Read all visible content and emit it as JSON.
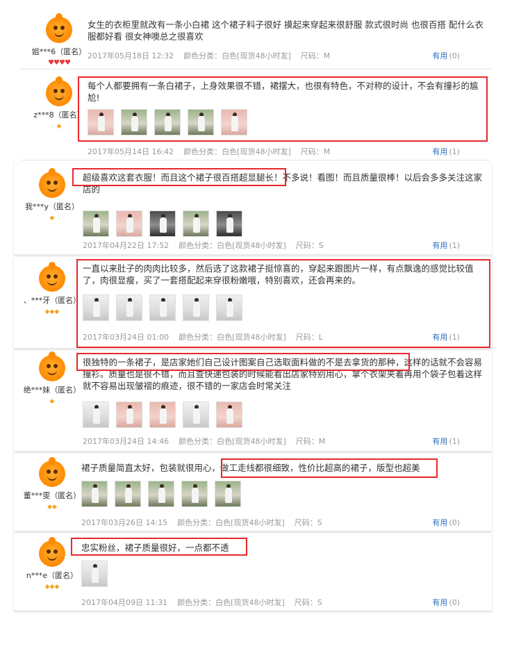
{
  "reviews": [
    {
      "user": "姐***6（匿名）",
      "badge": "hearts",
      "text": "女生的衣柜里就改有一条小白裙 这个裙子料子很好 摸起来穿起来很舒服 款式很时尚 也很百搭 配什么衣服都好看 很女神噢总之很喜欢",
      "date": "2017年05月18日 12:32",
      "color": "颜色分类：白色[现货48小时发]",
      "size": "尺码：M",
      "useful_label": "有用",
      "useful_count": "(0)",
      "pics": 0
    },
    {
      "user": "z***8（匿名）",
      "badge": "diamond1",
      "text": "每个人都要拥有一条白裙子，上身效果很不错，裙摆大，也很有特色，不对称的设计，不会有撞衫的尴尬!",
      "date": "2017年05月14日 16:42",
      "color": "颜色分类：白色[现货48小时发]",
      "size": "尺码：M",
      "useful_label": "有用",
      "useful_count": "(1)",
      "pics": 5
    },
    {
      "user": "我***y（匿名）",
      "badge": "diamond1",
      "text": "超级喜欢这套衣服！而且这个裙子很百搭超显腿长！不多说！看图！而且质量很棒！以后会多多关注这家店的",
      "date": "2017年04月22日 17:52",
      "color": "颜色分类：白色[现货48小时发]",
      "size": "尺码：S",
      "useful_label": "有用",
      "useful_count": "(1)",
      "pics": 5
    },
    {
      "user": "、***牙（匿名）",
      "badge": "diamond3",
      "text": "一直以来肚子的肉肉比较多，然后选了这款裙子挺惊喜的，穿起来跟图片一样，有点飘逸的感觉比较值了，肉很显瘦，买了一套搭配起来穿很粉嫩哦，特别喜欢，还会再来的。",
      "date": "2017年03月24日 01:00",
      "color": "颜色分类：白色[现货48小时发]",
      "size": "尺码：L",
      "useful_label": "有用",
      "useful_count": "(1)",
      "pics": 5
    },
    {
      "user": "绝***妹（匿名）",
      "badge": "diamond1",
      "text": "很独特的一条裙子，是店家她们自己设计图案自己选取面料做的不是去拿货的那种，这样的话就不会容易撞衫。质量也是很不错，而且查快递包装的时候能看出店家特别用心，拿个衣架夹着再用个袋子包着这样就不容易出现皱褶的痕迹，很不错的一家店会时常关注",
      "date": "2017年03月24日 14:46",
      "color": "颜色分类：白色[现货48小时发]",
      "size": "尺码：M",
      "useful_label": "有用",
      "useful_count": "(1)",
      "pics": 5
    },
    {
      "user": "董***雯（匿名）",
      "badge": "diamond2",
      "text": "裙子质量简直太好，包装就很用心，做工走线都很细致，性价比超高的裙子，版型也超美",
      "date": "2017年03月26日 14:15",
      "color": "颜色分类：白色[现货48小时发]",
      "size": "尺码：S",
      "useful_label": "有用",
      "useful_count": "(0)",
      "pics": 5
    },
    {
      "user": "n***e（匿名）",
      "badge": "diamond3",
      "text": "忠实粉丝，裙子质量很好，一点都不透",
      "date": "2017年04月09日 11:31",
      "color": "颜色分类：白色[现货48小时发]",
      "size": "尺码：S",
      "useful_label": "有用",
      "useful_count": "(0)",
      "pics": 1
    }
  ],
  "badges": {
    "hearts": "♥♥♥♥",
    "diamond1": "◆",
    "diamond2": "◆◆",
    "diamond3": "◆◆◆"
  },
  "colors": {
    "highlight": "#e8262b",
    "useful": "#2f6ec0",
    "avatar": "#ff8a00"
  }
}
